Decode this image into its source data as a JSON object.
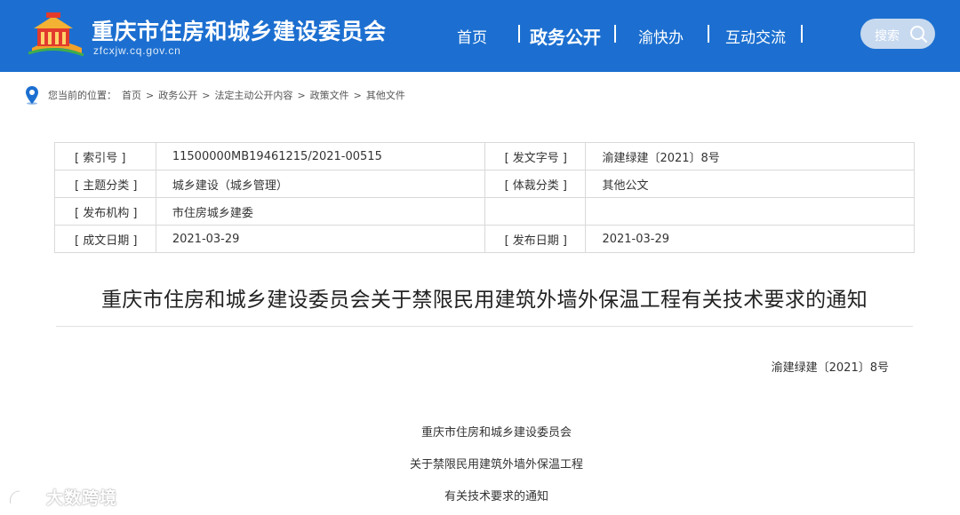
{
  "header": {
    "site_title": "重庆市住房和城乡建设委员会",
    "site_url": "zfcxjw.cq.gov.cn",
    "nav": [
      {
        "label": "首页",
        "active": false
      },
      {
        "label": "政务公开",
        "active": true
      },
      {
        "label": "渝快办",
        "active": false
      },
      {
        "label": "互动交流",
        "active": false
      }
    ],
    "search_label": "搜索",
    "colors": {
      "header_bg": "#1c6fd0",
      "search_bg": "#c7d9ef"
    }
  },
  "breadcrumb": {
    "prefix": "您当前的位置：",
    "items": [
      "首页",
      "政务公开",
      "法定主动公开内容",
      "政策文件",
      "其他文件"
    ],
    "separator": ">"
  },
  "meta": {
    "rows": [
      {
        "l1": "[ 索引号 ]",
        "v1": "11500000MB19461215/2021-00515",
        "l2": "[ 发文字号 ]",
        "v2": "渝建绿建〔2021〕8号"
      },
      {
        "l1": "[ 主题分类 ]",
        "v1": "城乡建设（城乡管理）",
        "l2": "[ 体裁分类 ]",
        "v2": "其他公文"
      },
      {
        "l1": "[ 发布机构 ]",
        "v1": "市住房城乡建委",
        "l2": "",
        "v2": ""
      },
      {
        "l1": "[ 成文日期 ]",
        "v1": "2021-03-29",
        "l2": "[ 发布日期 ]",
        "v2": "2021-03-29"
      }
    ]
  },
  "article": {
    "title": "重庆市住房和城乡建设委员会关于禁限民用建筑外墙外保温工程有关技术要求的通知",
    "doc_number": "渝建绿建〔2021〕8号",
    "body_lines": [
      "重庆市住房和城乡建设委员会",
      "关于禁限民用建筑外墙外保温工程",
      "有关技术要求的通知"
    ]
  },
  "watermark": {
    "text": "大数跨境",
    "icon": "speech-bubble-logo-icon"
  }
}
